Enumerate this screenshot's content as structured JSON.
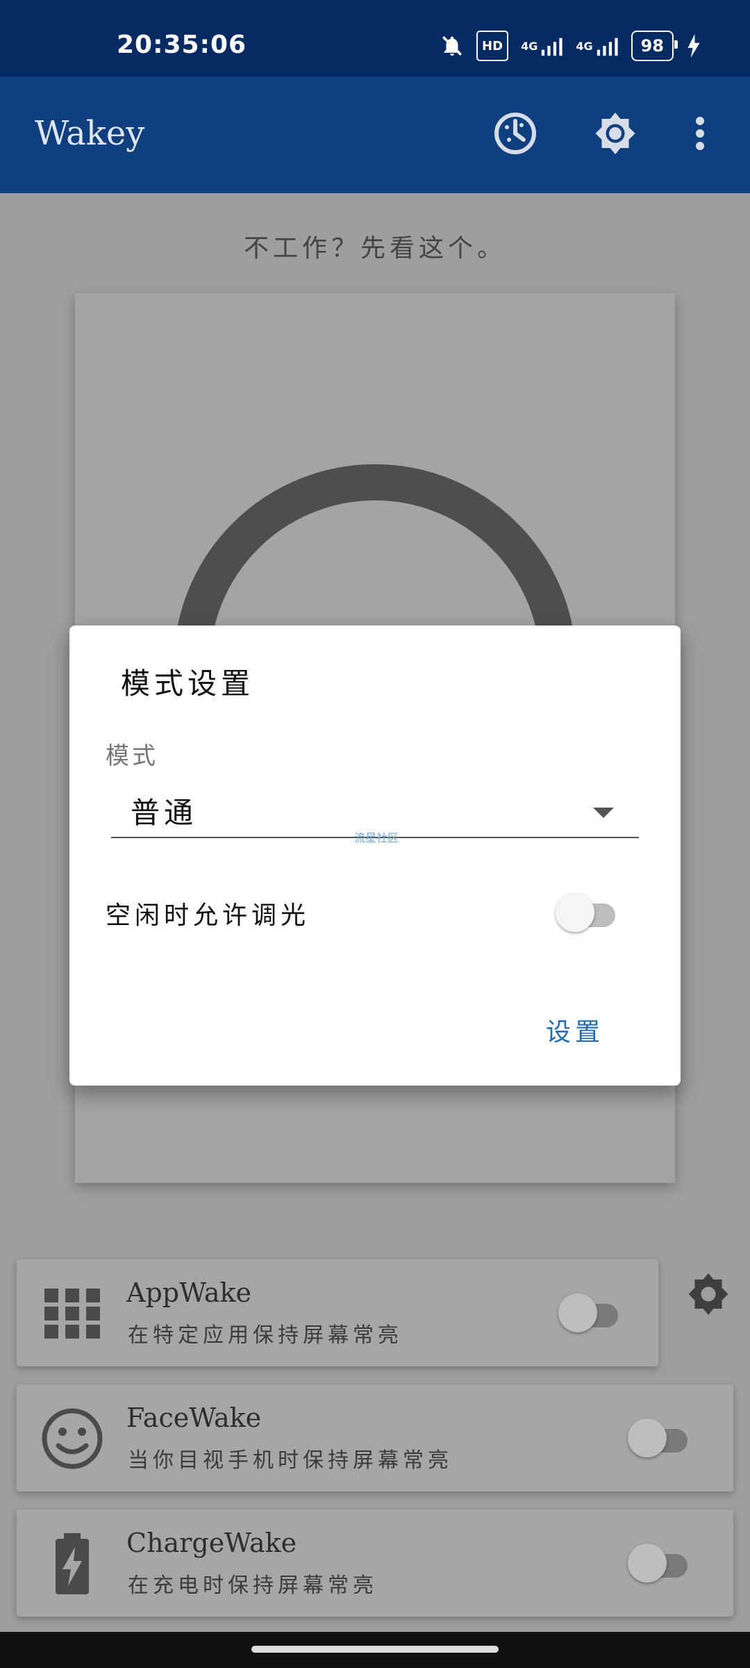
{
  "status": {
    "time": "20:35:06",
    "hd_label": "HD",
    "net1": "4G",
    "net2": "4G",
    "battery": "98"
  },
  "appbar": {
    "title": "Wakey"
  },
  "main": {
    "hint_text": "不工作？先看这个。"
  },
  "features": [
    {
      "title": "AppWake",
      "subtitle": "在特定应用保持屏幕常亮"
    },
    {
      "title": "FaceWake",
      "subtitle": "当你目视手机时保持屏幕常亮"
    },
    {
      "title": "ChargeWake",
      "subtitle": "在充电时保持屏幕常亮"
    }
  ],
  "dialog": {
    "title": "模式设置",
    "mode_label": "模式",
    "mode_value": "普通",
    "watermark": "流星社区",
    "switch_label": "空闲时允许调光",
    "confirm_button": "设置"
  },
  "colors": {
    "status_bar": "#062b62",
    "app_bar": "#103f7f",
    "accent": "#1f6bb6"
  }
}
